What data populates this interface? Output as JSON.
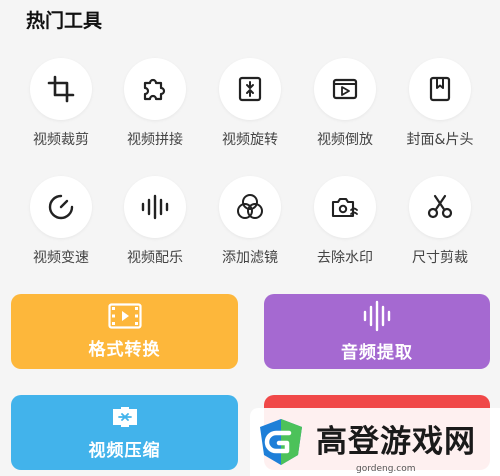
{
  "section": {
    "title": "热门工具"
  },
  "tools": [
    {
      "label": "视频裁剪",
      "icon": "crop-icon"
    },
    {
      "label": "视频拼接",
      "icon": "puzzle-icon"
    },
    {
      "label": "视频旋转",
      "icon": "rotate-icon"
    },
    {
      "label": "视频倒放",
      "icon": "reverse-play-icon"
    },
    {
      "label": "封面&片头",
      "icon": "bookmark-icon"
    },
    {
      "label": "视频变速",
      "icon": "speed-gauge-icon"
    },
    {
      "label": "视频配乐",
      "icon": "soundwave-icon"
    },
    {
      "label": "添加滤镜",
      "icon": "filter-circles-icon"
    },
    {
      "label": "去除水印",
      "icon": "remove-watermark-icon"
    },
    {
      "label": "尺寸剪裁",
      "icon": "scissors-icon"
    }
  ],
  "cards": [
    {
      "label": "格式转换",
      "color": "#fdb73b",
      "icon": "film-icon"
    },
    {
      "label": "音频提取",
      "color": "#a569d1",
      "icon": "audio-wave-icon"
    },
    {
      "label": "视频压缩",
      "color": "#42b3eb",
      "icon": "compress-icon"
    },
    {
      "label": "",
      "color": "#f04848",
      "icon": ""
    }
  ],
  "watermark": {
    "text": "高登游戏网",
    "sub": "gordeng.com"
  }
}
